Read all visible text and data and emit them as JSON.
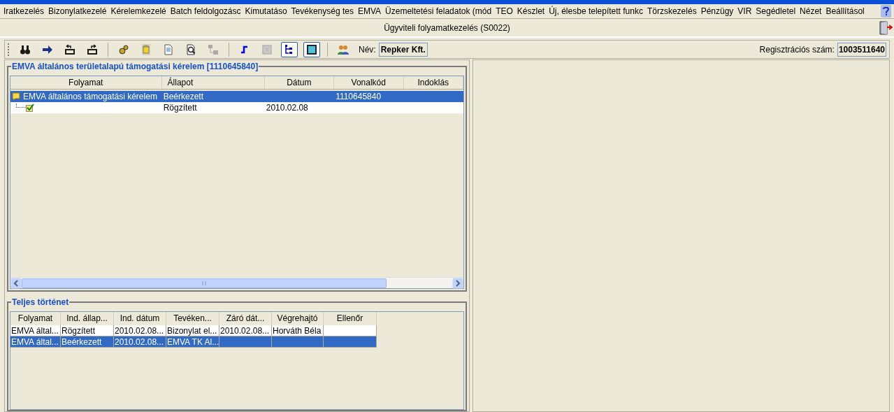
{
  "menu": [
    "Iratkezelés",
    "Bizonylatkezelé",
    "Kérelemkezelé",
    "Batch feldolgozásc",
    "Kimutatáso",
    "Tevékenység tes",
    "EMVA",
    "Üzemeltetési feladatok (mód",
    "TEO",
    "Készlet",
    "Új, élesbe telepített funkc",
    "Törzskezelés",
    "Pénzügy",
    "VIR",
    "Segédletel",
    "Nézet",
    "Beállításol"
  ],
  "window": {
    "title": "Ügyviteli folyamatkezelés (S0022)"
  },
  "toolbar": {
    "groups": [
      [
        {
          "pressed": false,
          "disabled": false
        },
        {
          "pressed": false,
          "disabled": false
        },
        {
          "pressed": false,
          "disabled": false
        },
        {
          "pressed": false,
          "disabled": false
        }
      ],
      [
        {
          "pressed": false,
          "disabled": false
        },
        {
          "pressed": false,
          "disabled": false
        },
        {
          "pressed": false,
          "disabled": false
        },
        {
          "pressed": false,
          "disabled": false
        },
        {
          "pressed": false,
          "disabled": true
        }
      ],
      [
        {
          "pressed": false,
          "disabled": false
        },
        {
          "pressed": false,
          "disabled": true
        },
        {
          "pressed": true,
          "disabled": false
        },
        {
          "pressed": true,
          "disabled": false
        }
      ],
      [
        {
          "pressed": false,
          "disabled": false
        }
      ]
    ],
    "name_label": "Név:",
    "name_value": "Repker Kft.",
    "reg_label": "Regisztrációs szám:",
    "reg_value": "1003511640"
  },
  "process_panel": {
    "title": "EMVA általános területalapú támogatási kérelem [1110645840]",
    "columns": [
      "Folyamat",
      "Állapot",
      "Dátum",
      "Vonalkód",
      "Indoklás"
    ],
    "rows": [
      {
        "cells": [
          "EMVA általános támogatási kérelem",
          "Beérkezett",
          "",
          "1110645840",
          ""
        ],
        "selected": true,
        "children": [
          {
            "cells": [
              "",
              "Rögzített",
              "2010.02.08",
              "",
              ""
            ],
            "selected": false
          }
        ]
      }
    ]
  },
  "history_panel": {
    "title": "Teljes történet",
    "columns": [
      "Folyamat",
      "Ind. állap...",
      "Ind. dátum",
      "Tevéken...",
      "Záró dát...",
      "Végrehajtó",
      "Ellenőr"
    ],
    "rows": [
      {
        "cells": [
          "EMVA által...",
          "Rögzített",
          "2010.02.08...",
          "Bizonylat el...",
          "2010.02.08...",
          "Horváth Béla",
          ""
        ],
        "selected": false
      },
      {
        "cells": [
          "EMVA által...",
          "Beérkezett",
          "2010.02.08...",
          "EMVA TK Al...",
          "",
          "",
          ""
        ],
        "selected": true
      }
    ]
  }
}
